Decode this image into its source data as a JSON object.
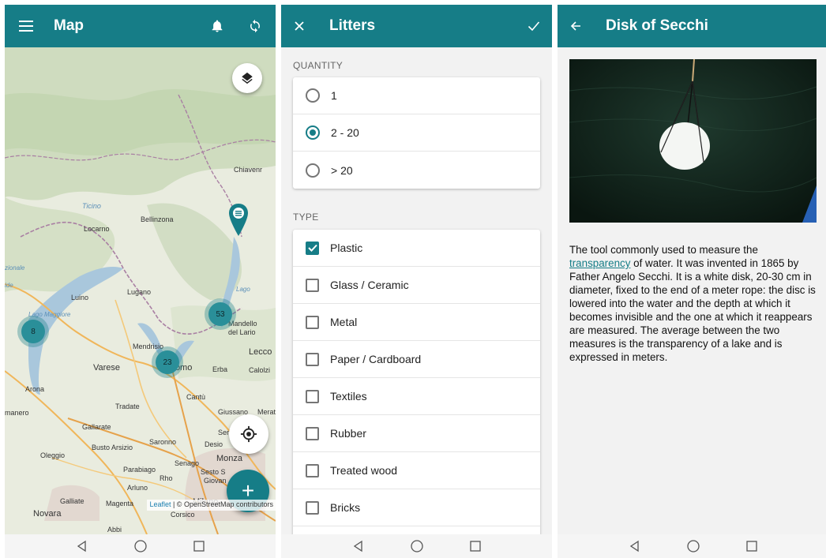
{
  "map_screen": {
    "title": "Map",
    "icons": {
      "menu": "menu-icon",
      "notifications": "bell-icon",
      "sync": "sync-icon",
      "layers": "layers-icon",
      "locate": "crosshair-icon",
      "add": "plus-icon"
    },
    "labels": [
      "Chiavenr",
      "Ticino",
      "Bellinzona",
      "Locarno",
      "Lugano",
      "Luino",
      "Lago Maggiore",
      "Mandello",
      "del Lario",
      "Lecco",
      "Mendrisio",
      "Varese",
      "Como",
      "Erba",
      "Calolzi",
      "Arona",
      "Tradate",
      "Cantù",
      "Giussano",
      "Merat",
      "manero",
      "Gallarate",
      "Busto Arsizio",
      "Saronno",
      "Seregno",
      "Desio",
      "Oleggio",
      "Parabiago",
      "Senago",
      "Monza",
      "Sesto S",
      "Giovan",
      "Rho",
      "Arluno",
      "Galliate",
      "Magenta",
      "Milano",
      "Novara",
      "Corsico",
      "Abbi",
      "zionale",
      "ide",
      "Lago"
    ],
    "clusters": [
      {
        "count": "53"
      },
      {
        "count": "8"
      },
      {
        "count": "23"
      }
    ],
    "attribution": {
      "link": "Leaflet",
      "text": " | © OpenStreetMap contributors"
    },
    "add_label": "+",
    "colors": {
      "accent": "#167d87",
      "water": "#a9c7dc",
      "land": "#e9ecdf"
    }
  },
  "form_screen": {
    "title": "Litters",
    "close_icon": "close-icon",
    "confirm_icon": "check-icon",
    "quantity_header": "QUANTITY",
    "quantity_options": [
      {
        "label": "1",
        "selected": false
      },
      {
        "label": "2 - 20",
        "selected": true
      },
      {
        "label": "> 20",
        "selected": false
      }
    ],
    "type_header": "TYPE",
    "type_options": [
      {
        "label": "Plastic",
        "checked": true
      },
      {
        "label": "Glass / Ceramic",
        "checked": false
      },
      {
        "label": "Metal",
        "checked": false
      },
      {
        "label": "Paper / Cardboard",
        "checked": false
      },
      {
        "label": "Textiles",
        "checked": false
      },
      {
        "label": "Rubber",
        "checked": false
      },
      {
        "label": "Treated wood",
        "checked": false
      },
      {
        "label": "Bricks",
        "checked": false
      }
    ]
  },
  "detail_screen": {
    "title": "Disk of Secchi",
    "back_icon": "arrow-back-icon",
    "photo": "secchi-disk-photo",
    "text_before": "The tool commonly used to measure the ",
    "link": "transparency",
    "text_after": " of water. It was invented in 1865 by Father Angelo Secchi. It is a white disk, 20-30 cm in diameter, fixed to the end of a meter rope: the disc is lowered into the water and the depth at which it becomes invisible and the one at which it reappears are measured. The average between the two measures is the transparency of a lake and is expressed in meters."
  },
  "navbar": {
    "back": "nav-back-icon",
    "home": "nav-home-icon",
    "recents": "nav-recents-icon"
  }
}
